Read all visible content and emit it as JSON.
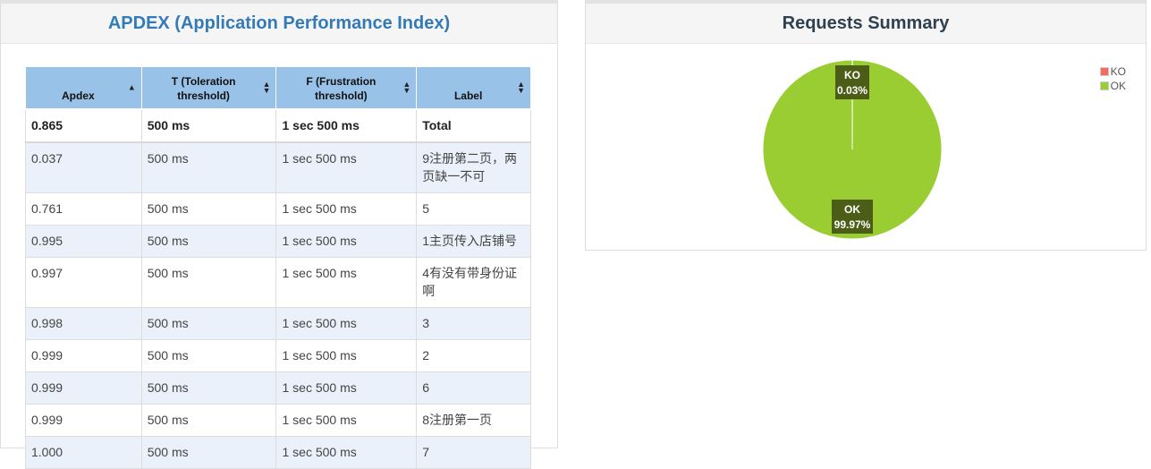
{
  "apdex_panel": {
    "title": "APDEX (Application Performance Index)",
    "columns": [
      "Apdex",
      "T (Toleration threshold)",
      "F (Frustration threshold)",
      "Label"
    ],
    "total_row": [
      "0.865",
      "500 ms",
      "1 sec 500 ms",
      "Total"
    ],
    "rows": [
      [
        "0.037",
        "500 ms",
        "1 sec 500 ms",
        "9注册第二页，两页缺一不可"
      ],
      [
        "0.761",
        "500 ms",
        "1 sec 500 ms",
        "5"
      ],
      [
        "0.995",
        "500 ms",
        "1 sec 500 ms",
        "1主页传入店铺号"
      ],
      [
        "0.997",
        "500 ms",
        "1 sec 500 ms",
        "4有没有带身份证啊"
      ],
      [
        "0.998",
        "500 ms",
        "1 sec 500 ms",
        "3"
      ],
      [
        "0.999",
        "500 ms",
        "1 sec 500 ms",
        "2"
      ],
      [
        "0.999",
        "500 ms",
        "1 sec 500 ms",
        "6"
      ],
      [
        "0.999",
        "500 ms",
        "1 sec 500 ms",
        "8注册第一页"
      ],
      [
        "1.000",
        "500 ms",
        "1 sec 500 ms",
        "7"
      ]
    ]
  },
  "summary_panel": {
    "title": "Requests Summary"
  },
  "chart_data": {
    "type": "pie",
    "title": "Requests Summary",
    "slices": [
      {
        "name": "KO",
        "value": 0.03,
        "label": "0.03%",
        "color": "#f56b5b"
      },
      {
        "name": "OK",
        "value": 99.97,
        "label": "99.97%",
        "color": "#9acd32"
      }
    ],
    "legend": [
      "KO",
      "OK"
    ],
    "legend_position": "top-right"
  }
}
